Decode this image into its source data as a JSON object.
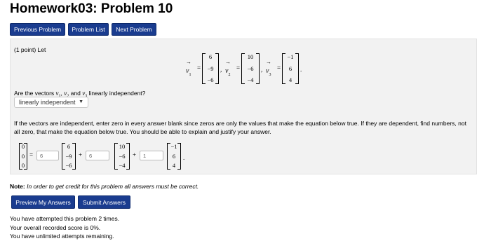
{
  "page": {
    "title": "Homework03: Problem 10"
  },
  "nav": {
    "previous": "Previous Problem",
    "list": "Problem List",
    "next": "Next Problem"
  },
  "problem": {
    "points": "(1 point) Let",
    "v1_label": "v",
    "v1_sub": "1",
    "v1": [
      "6",
      "−9",
      "−6"
    ],
    "v2_label": "v",
    "v2_sub": "2",
    "v2": [
      "10",
      "−6",
      "−4"
    ],
    "v3_label": "v",
    "v3_sub": "3",
    "v3": [
      "−1",
      "6",
      "4"
    ],
    "question": "Are the vectors",
    "question_tail": "linearly independent?",
    "select_value": "linearly independent",
    "instructions": "If the vectors are independent, enter zero in every answer blank since zeros are only the values that make the equation below true. If they are dependent, find numbers, not all zero, that make the equation below true. You should be able to explain and justify your answer.",
    "zero_vec": [
      "0",
      "0",
      "0"
    ],
    "answers": [
      "6",
      "6",
      "1"
    ]
  },
  "note": {
    "label": "Note:",
    "text": "In order to get credit for this problem all answers must be correct."
  },
  "actions": {
    "preview": "Preview My Answers",
    "submit": "Submit Answers"
  },
  "status": {
    "attempts": "You have attempted this problem 2 times.",
    "score": "Your overall recorded score is 0%.",
    "remaining": "You have unlimited attempts remaining."
  }
}
